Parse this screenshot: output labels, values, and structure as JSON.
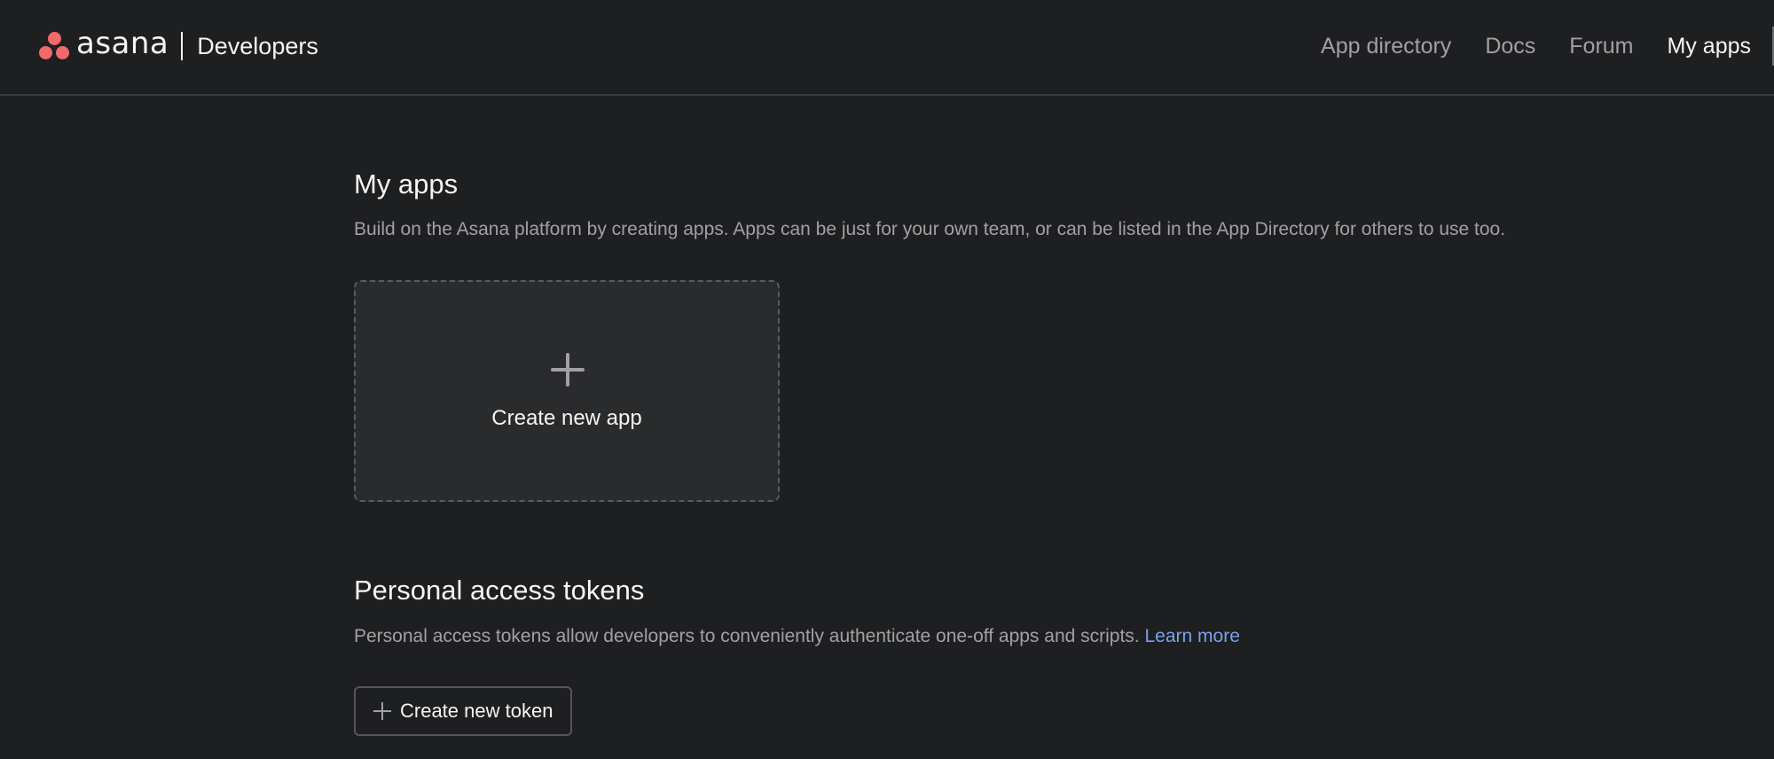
{
  "header": {
    "logo_wordmark": "asana",
    "logo_subtitle": "Developers",
    "nav": [
      {
        "label": "App directory"
      },
      {
        "label": "Docs"
      },
      {
        "label": "Forum"
      },
      {
        "label": "My apps",
        "active": true
      }
    ]
  },
  "my_apps": {
    "title": "My apps",
    "description": "Build on the Asana platform by creating apps. Apps can be just for your own team, or can be listed in the App Directory for others to use too.",
    "create_card": {
      "icon": "plus-icon",
      "label": "Create new app"
    }
  },
  "tokens": {
    "title": "Personal access tokens",
    "description": "Personal access tokens allow developers to conveniently authenticate one-off apps and scripts. ",
    "learn_more": "Learn more",
    "create_button": {
      "icon": "plus-icon",
      "label": "Create new token"
    }
  },
  "colors": {
    "background": "#1e1f21",
    "brand_coral": "#f06a6a",
    "link": "#7ba1eb"
  }
}
